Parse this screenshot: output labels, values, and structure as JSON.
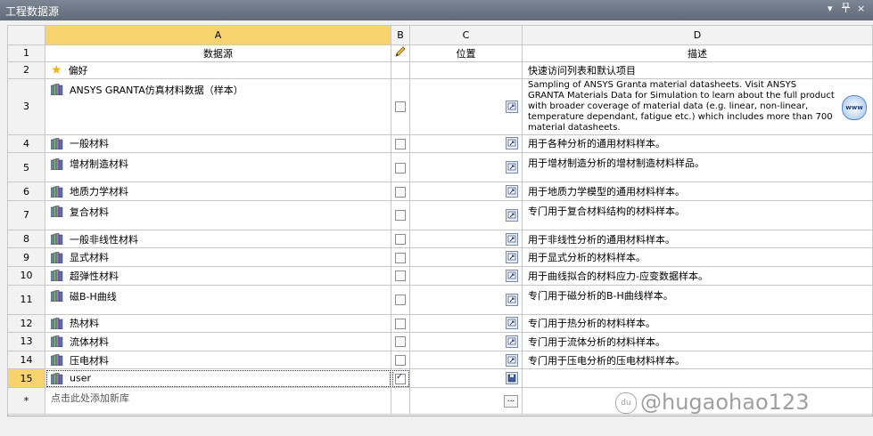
{
  "window": {
    "title": "工程数据源",
    "controls": [
      "▾",
      "ᵩ",
      "×"
    ]
  },
  "columns": {
    "row_col": "",
    "a": "A",
    "b": "B",
    "c": "C",
    "d": "D"
  },
  "header": {
    "a": "数据源",
    "b_icon": "pencil-icon",
    "c": "位置",
    "d": "描述",
    "row": "1"
  },
  "rows": [
    {
      "num": "2",
      "icon": "star-icon",
      "name": "偏好",
      "checkbox": null,
      "loc": false,
      "desc": "快速访问列表和默认项目"
    },
    {
      "num": "3",
      "icon": "library-icon",
      "name": "ANSYS GRANTA仿真材料数据（样本）",
      "checkbox": false,
      "loc": true,
      "desc": "Sampling of ANSYS Granta material datasheets. Visit ANSYS GRANTA Materials Data for Simulation to learn about the full product with broader coverage of material data (e.g. linear, non-linear, temperature dependant, fatigue etc.) which includes more than 700 material datasheets.",
      "www": "www"
    },
    {
      "num": "4",
      "icon": "library-icon",
      "name": "一般材料",
      "checkbox": false,
      "loc": true,
      "desc": "用于各种分析的通用材料样本。"
    },
    {
      "num": "5",
      "icon": "library-icon",
      "name": "增材制造材料",
      "checkbox": false,
      "loc": true,
      "desc": "用于增材制造分析的增材制造材料样品。"
    },
    {
      "num": "6",
      "icon": "library-icon",
      "name": "地质力学材料",
      "checkbox": false,
      "loc": true,
      "desc": "用于地质力学模型的通用材料样本。"
    },
    {
      "num": "7",
      "icon": "library-icon",
      "name": "复合材料",
      "checkbox": false,
      "loc": true,
      "desc": "专门用于复合材料结构的材料样本。"
    },
    {
      "num": "8",
      "icon": "library-icon",
      "name": "一般非线性材料",
      "checkbox": false,
      "loc": true,
      "desc": "用于非线性分析的通用材料样本。"
    },
    {
      "num": "9",
      "icon": "library-icon",
      "name": "显式材料",
      "checkbox": false,
      "loc": true,
      "desc": "用于显式分析的材料样本。"
    },
    {
      "num": "10",
      "icon": "library-icon",
      "name": "超弹性材料",
      "checkbox": false,
      "loc": true,
      "desc": "用于曲线拟合的材料应力-应变数据样本。"
    },
    {
      "num": "11",
      "icon": "library-icon",
      "name": "磁B-H曲线",
      "checkbox": false,
      "loc": true,
      "desc": "专门用于磁分析的B-H曲线样本。"
    },
    {
      "num": "12",
      "icon": "library-icon",
      "name": "热材料",
      "checkbox": false,
      "loc": true,
      "desc": "专门用于热分析的材料样本。"
    },
    {
      "num": "13",
      "icon": "library-icon",
      "name": "流体材料",
      "checkbox": false,
      "loc": true,
      "desc": "专门用于流体分析的材料样本。"
    },
    {
      "num": "14",
      "icon": "library-icon",
      "name": "压电材料",
      "checkbox": false,
      "loc": true,
      "desc": "专门用于压电分析的压电材料样本。"
    },
    {
      "num": "15",
      "icon": "library-icon",
      "name": "user",
      "checkbox": true,
      "loc": true,
      "desc": ""
    }
  ],
  "new_row": {
    "num": "*",
    "placeholder": "点击此处添加新库",
    "browse": "..."
  },
  "watermark": "@hugaohao123",
  "colors": {
    "selected_header": "#f7d36e",
    "title_bar": "#6c7684"
  }
}
